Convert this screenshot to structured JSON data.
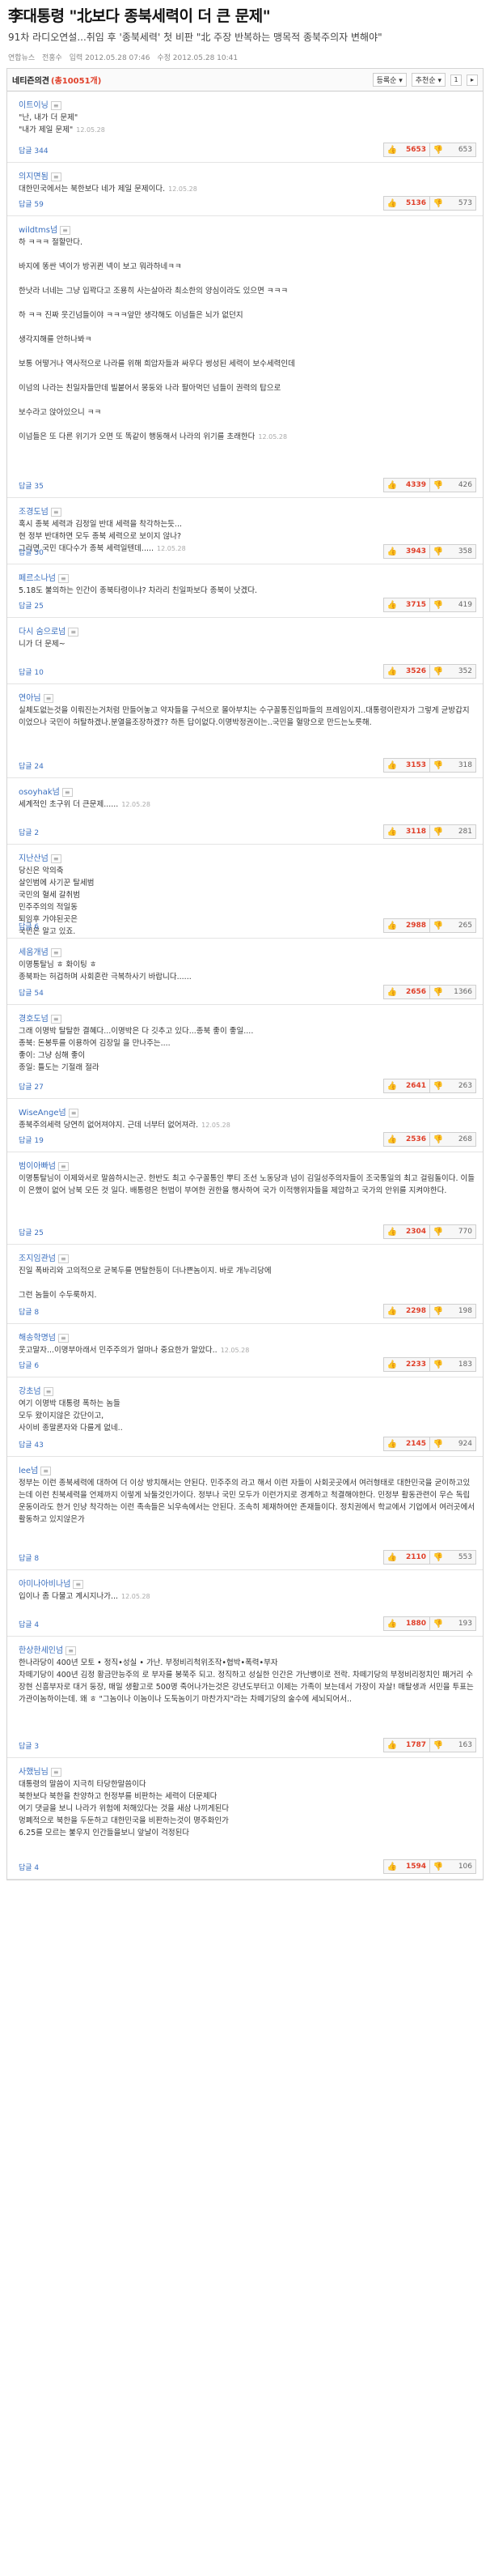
{
  "article": {
    "headline": "李대통령 \"北보다 종북세력이 더 큰 문제\"",
    "subhead": "91차 라디오연설...취임 후 '종북세력' 첫 비판 \"北 주장 반복하는 맹목적 종북주의자 변해야\"",
    "meta": [
      "연합뉴스",
      "전홍수",
      "입력 2012.05.28 07:46",
      "수정 2012.05.28 10:41"
    ]
  },
  "comments_header": {
    "title": "네티즌의견",
    "count": "(총10051개)",
    "sort1": "등록순 ▾",
    "sort2": "추천순 ▾",
    "page": "1",
    "next": "▸"
  },
  "icons": {
    "thumb_up": "thumbs-up-icon",
    "thumb_down": "thumbs-down-icon"
  },
  "comments": [
    {
      "author": "이트이닝",
      "time": "12.05.28",
      "lines": [
        "\"난, 내가 더 문제\"",
        "\"내가 제일 문제\""
      ],
      "reply": "답글 344",
      "up": "5653",
      "down": "653"
    },
    {
      "author": "의지면됨",
      "time": "12.05.28",
      "lines": [
        "대한민국에서는 북한보다 네가 제일 문제이다."
      ],
      "reply": "답글 59",
      "up": "5136",
      "down": "573"
    },
    {
      "author": "wildtms넘",
      "time": "12.05.28",
      "lines": [
        "하 ㅋㅋㅋ 절할만다.",
        "",
        "바지에 똥싼 넥이가 방귀뀐 넥이 보고 뭐라하네ㅋㅋ",
        "",
        "한낫라 너네는 그냥 입꽉다고 조용히 사는살아라 최소한의 양심이라도 있으면 ㅋㅋㅋ",
        "",
        "하 ㅋㅋ 진짜 웃긴넘들이야 ㅋㅋㅋ앞만 생각해도 이넘들은 뇌가 없던지",
        "",
        "생각지해를 안하나봐ㅋ",
        "",
        "보통 어떻거나 역사적으로 나라를 위해 희압자들과 싸우다 썽성된 세력이 보수세력인데",
        "",
        "이넘의 나라는 친일자들만데 빌붙어서 몽둥와 나라 팔아먹던 넘들이 권력의 탑으로",
        "",
        "보수라고 앉아있으니 ㅋㅋ",
        "",
        "이넘들은 또 다른 위기가 오면 또 똑같이 행동해서 나라의 위기를 초래한다"
      ],
      "reply": "답글 35",
      "up": "4339",
      "down": "426"
    },
    {
      "author": "조경도넘",
      "time": "12.05.28",
      "lines": [
        "혹시 종북 세력과 김정일 반대 세력을 착각하는듯...",
        "현 정부 반대하면 모두 종북 세력으로 보이지 않나?",
        "그러면 국민 대다수가 종북 세력일텐데....."
      ],
      "reply": "답글 30",
      "up": "3943",
      "down": "358"
    },
    {
      "author": "페르소나넘",
      "time": "",
      "lines": [
        "5.18도 불의하는 인간이 종북타령이냐? 차라리 친일파보다 종북이 낫겠다."
      ],
      "reply": "답글 25",
      "up": "3715",
      "down": "419"
    },
    {
      "author": "다시 숨으로넘",
      "time": "",
      "lines": [
        "니가 더 문제~"
      ],
      "reply": "답글 10",
      "up": "3526",
      "down": "352"
    },
    {
      "author": "연아님",
      "time": "",
      "lines": [
        "실체도없는것을 이뤄진는거처럼 만들어놓고 약자들을 구석으로 몰아부치는 수구꼴통진입파들의 프레임이지..대통령이란자가 그렇게 균방갑지이었으나 국민이 허탈하겠나.분열을조장하겠?? 하튼 답이없다.이명박정권이는..국민을 혈망으로 만드는노릇해."
      ],
      "reply": "답글 24",
      "up": "3153",
      "down": "318"
    },
    {
      "author": "osoyhak넘",
      "time": "12.05.28",
      "lines": [
        "세계적인 초구위 더 큰문제......"
      ],
      "reply": "답글 2",
      "up": "3118",
      "down": "281"
    },
    {
      "author": "지난산넘",
      "time": "",
      "lines": [
        "당신은 악의축",
        "살인범에 사기꾼 탈세범",
        "국민의 혈세 갈취범",
        "민주주의의 적일동",
        "퇴임후 가야된곳은",
        "국민은 알고 있죠."
      ],
      "reply": "답글 6",
      "up": "2988",
      "down": "265"
    },
    {
      "author": "세움개념",
      "time": "",
      "lines": [
        "이명통탈님 ㅎ 화이팅 ㅎ",
        "종북파는 허겁하며 사회혼란 극복하사기 바랍니다......"
      ],
      "reply": "답글 54",
      "up": "2656",
      "down": "1366"
    },
    {
      "author": "경호도넘",
      "time": "",
      "lines": [
        "그래 이명박 탈탈한 결혜다...이명박은 다 깃추고 있다...종북 좋이 좋일....",
        "종북: 돈봉투를 이용하여 김장일 을 만나주는....",
        "좋이: 그냥 심해 좋이",
        "종일: 틀도는 기절래 절라"
      ],
      "reply": "답글 27",
      "up": "2641",
      "down": "263"
    },
    {
      "author": "WiseAnge넘",
      "time": "12.05.28",
      "lines": [
        "종북주의세력 당연히 없어져야지. 근데 너부터 없어져라."
      ],
      "reply": "답글 19",
      "up": "2536",
      "down": "268"
    },
    {
      "author": "범이아빠넘",
      "time": "",
      "lines": [
        "이명통탈님이 이제와서로 말씀하시는군. 한반도 최고 수구꼴통인 뿌티 조선 노동당과 넘이 김일성주의자들이 조국통일의 최고 걸림돌이다. 이들이 은했이 없어 남북 모든 것 일다. 배통령은 헌법이 부여한 권한을 행사하여 국가 이적행위자들을 제압하고 국가의 안위를 지켜야한다."
      ],
      "reply": "답글 25",
      "up": "2304",
      "down": "770"
    },
    {
      "author": "조지임관넘",
      "time": "",
      "lines": [
        "진일 폭바리와 고의적으로 균복두를 면탈한등이 더나쁜놈이지. 바로 개누리당에",
        "",
        "그런 놈들이 수두룩하지."
      ],
      "reply": "답글 8",
      "up": "2298",
      "down": "198"
    },
    {
      "author": "해송학명넘",
      "time": "12.05.28",
      "lines": [
        "웃고말자...이명부아래서 민주주의가 얼마나 중요한가 알았다.."
      ],
      "reply": "답글 6",
      "up": "2233",
      "down": "183"
    },
    {
      "author": "강초넘",
      "time": "",
      "lines": [
        "여기 이명박 대통령 폭하는 놈들",
        "모두 왔이지않은 갔단이고,",
        "사이비 종말론자와 다를게 없네.."
      ],
      "reply": "답글 43",
      "up": "2145",
      "down": "924"
    },
    {
      "author": "lee넘",
      "time": "",
      "lines": [
        "정부는 이런 종북세력에 대하여 더 이상 방치해서는 안된다. 민주주의 라고 해서 이런 자들이 사회곳곳에서 여러형태로 대한민국을 굳이하고있는데 이런 친북세력을 언제까지 이렇게 놔둘것인가이다. 정부나 국민 모두가 이런가지로 경계하고 척결해야한다. 민정부 활동관련이 무슨 독립운동이라도 한거 인냥 착각하는 이런 족속들은 뇌우속에서는 안된다. 조속히 제재하여안 존재들이다. 정치권에서 학교에서 기업에서 여러곳에서 활동하고 있지않은가"
      ],
      "reply": "답글 8",
      "up": "2110",
      "down": "553"
    },
    {
      "author": "아미나아비나넘",
      "time": "12.05.28",
      "lines": [
        "입이나 좀 다물고 계시지나가..."
      ],
      "reply": "답글 4",
      "up": "1880",
      "down": "193"
    },
    {
      "author": "한상한세인넘",
      "time": "",
      "lines": [
        "한나라당이 400년 모토 • 정직•성실 • 가난. 부정비리척위조작•협박•폭력•부자",
        "차떼기당이 400년 김정 황금만능주의 로 부자를 봉쭉주 되고. 정직하고 성실한 인간은 가난뱅이로 전락. 차떼기당의 부정비리정치인 패거리 수장현 신흥부자로 대거 둥장, 매일 생활고로 500명 죽어나가는것은 강년도부터고 이제는 가족이 보는데서 가장이 자살! 매탈생과 서민을 투표는 가관이놈하이는데. 왜 ㅎ \"그놈이나 이놈이나 도둑놈이기 마찬가지\"라는 차떼기당의 술수에 세뇌되어서.."
      ],
      "reply": "답글 3",
      "up": "1787",
      "down": "163"
    },
    {
      "author": "사했님님",
      "time": "",
      "lines": [
        "대통령의 말씀이 지극히 타당한말씀이다",
        "북한보다 북한을 찬양하고 헌정부를 비판하는 세력이 더문제다",
        "여기 댓글을 보니 나라가 위험에 처해있다는 것을 새삼 나끼게된다",
        "멍폐적으로 북한을 두둔하고 대한민국을 비판하는것이 명주화인가",
        "6.25를 모르는 불우지 인간들을보니 앞날이 걱정된다"
      ],
      "reply": "답글 4",
      "up": "1594",
      "down": "106"
    }
  ]
}
